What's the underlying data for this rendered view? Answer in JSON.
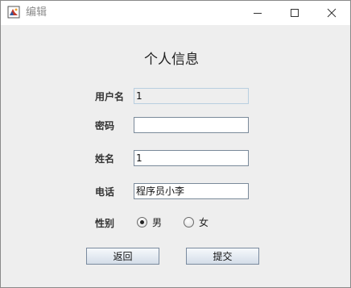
{
  "window": {
    "title": "编辑"
  },
  "form": {
    "heading": "个人信息",
    "username": {
      "label": "用户名",
      "value": "1"
    },
    "password": {
      "label": "密码",
      "value": ""
    },
    "name": {
      "label": "姓名",
      "value": "1"
    },
    "phone": {
      "label": "电话",
      "value": "程序员小李"
    },
    "gender": {
      "label": "性别",
      "options": [
        {
          "label": "男",
          "checked": true
        },
        {
          "label": "女",
          "checked": false
        }
      ]
    }
  },
  "buttons": {
    "back": "返回",
    "submit": "提交"
  },
  "icons": {
    "app": "java-coffee-cup-icon",
    "minimize": "minimize-icon",
    "maximize": "maximize-icon",
    "close": "close-icon"
  }
}
